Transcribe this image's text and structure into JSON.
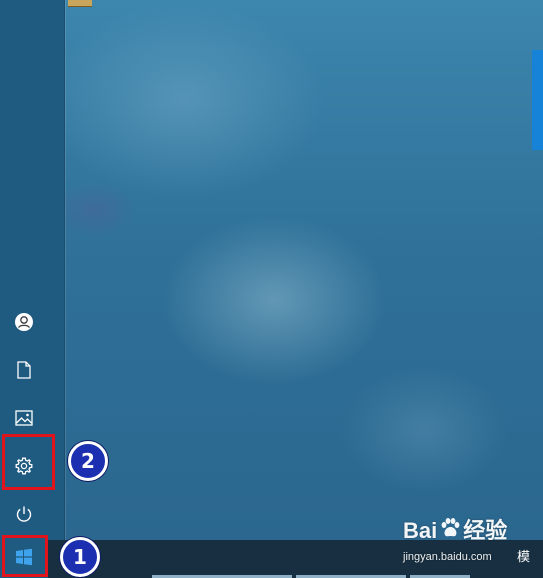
{
  "start_menu": {
    "rail_items": [
      {
        "icon": "user-icon"
      },
      {
        "icon": "document-icon"
      },
      {
        "icon": "pictures-icon"
      },
      {
        "icon": "gear-icon"
      },
      {
        "icon": "power-icon"
      }
    ]
  },
  "taskbar": {
    "start_icon": "windows-logo-icon",
    "ime_indicator": "模"
  },
  "annotations": {
    "badge_1": "1",
    "badge_2": "2",
    "highlight_color": "#e0141c",
    "badge_color": "#1b2fb0"
  },
  "watermark": {
    "logo_left": "Bai",
    "logo_right": "经验",
    "url": "jingyan.baidu.com"
  },
  "colors": {
    "rail_bg": "#1f5a80",
    "taskbar_bg": "#172f40",
    "accent_tile": "#1683d8"
  }
}
